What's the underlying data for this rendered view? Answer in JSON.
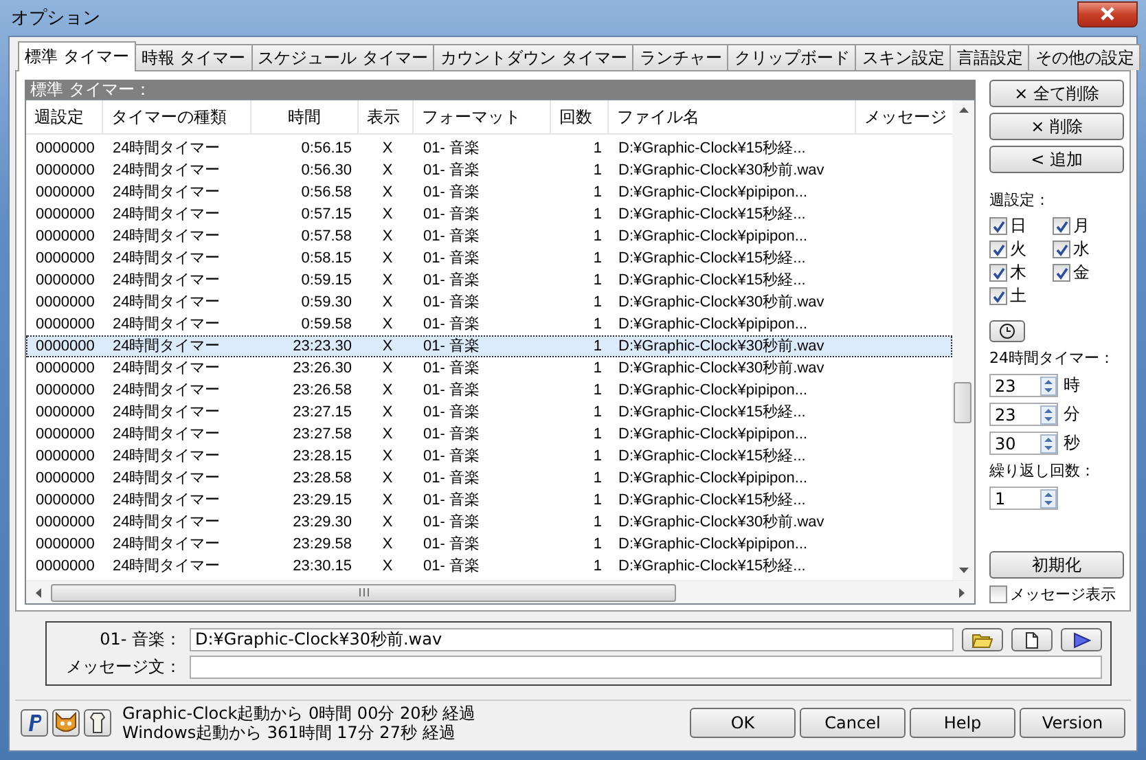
{
  "window": {
    "title": "オプション"
  },
  "tabs": [
    {
      "label": "標準 タイマー",
      "selected": true
    },
    {
      "label": "時報 タイマー",
      "selected": false
    },
    {
      "label": "スケジュール タイマー",
      "selected": false
    },
    {
      "label": "カウントダウン タイマー",
      "selected": false
    },
    {
      "label": "ランチャー",
      "selected": false
    },
    {
      "label": "クリップボード",
      "selected": false
    },
    {
      "label": "スキン設定",
      "selected": false
    },
    {
      "label": "言語設定",
      "selected": false
    },
    {
      "label": "その他の設定",
      "selected": false
    }
  ],
  "table": {
    "group_label": "標準 タイマー：",
    "columns": [
      "週設定",
      "タイマーの種類",
      "時間",
      "表示",
      "フォーマット",
      "回数",
      "ファイル名",
      "メッセージ"
    ],
    "rows": [
      {
        "cells": [
          "0000000",
          "24時間タイマー",
          "0:56.15",
          "X",
          "01- 音楽",
          "1",
          "D:¥Graphic-Clock¥15秒経..."
        ],
        "selected": false
      },
      {
        "cells": [
          "0000000",
          "24時間タイマー",
          "0:56.30",
          "X",
          "01- 音楽",
          "1",
          "D:¥Graphic-Clock¥30秒前.wav"
        ],
        "selected": false
      },
      {
        "cells": [
          "0000000",
          "24時間タイマー",
          "0:56.58",
          "X",
          "01- 音楽",
          "1",
          "D:¥Graphic-Clock¥pipipon..."
        ],
        "selected": false
      },
      {
        "cells": [
          "0000000",
          "24時間タイマー",
          "0:57.15",
          "X",
          "01- 音楽",
          "1",
          "D:¥Graphic-Clock¥15秒経..."
        ],
        "selected": false
      },
      {
        "cells": [
          "0000000",
          "24時間タイマー",
          "0:57.58",
          "X",
          "01- 音楽",
          "1",
          "D:¥Graphic-Clock¥pipipon..."
        ],
        "selected": false
      },
      {
        "cells": [
          "0000000",
          "24時間タイマー",
          "0:58.15",
          "X",
          "01- 音楽",
          "1",
          "D:¥Graphic-Clock¥15秒経..."
        ],
        "selected": false
      },
      {
        "cells": [
          "0000000",
          "24時間タイマー",
          "0:59.15",
          "X",
          "01- 音楽",
          "1",
          "D:¥Graphic-Clock¥15秒経..."
        ],
        "selected": false
      },
      {
        "cells": [
          "0000000",
          "24時間タイマー",
          "0:59.30",
          "X",
          "01- 音楽",
          "1",
          "D:¥Graphic-Clock¥30秒前.wav"
        ],
        "selected": false
      },
      {
        "cells": [
          "0000000",
          "24時間タイマー",
          "0:59.58",
          "X",
          "01- 音楽",
          "1",
          "D:¥Graphic-Clock¥pipipon..."
        ],
        "selected": false
      },
      {
        "cells": [
          "0000000",
          "24時間タイマー",
          "23:23.30",
          "X",
          "01- 音楽",
          "1",
          "D:¥Graphic-Clock¥30秒前.wav"
        ],
        "selected": true
      },
      {
        "cells": [
          "0000000",
          "24時間タイマー",
          "23:26.30",
          "X",
          "01- 音楽",
          "1",
          "D:¥Graphic-Clock¥30秒前.wav"
        ],
        "selected": false
      },
      {
        "cells": [
          "0000000",
          "24時間タイマー",
          "23:26.58",
          "X",
          "01- 音楽",
          "1",
          "D:¥Graphic-Clock¥pipipon..."
        ],
        "selected": false
      },
      {
        "cells": [
          "0000000",
          "24時間タイマー",
          "23:27.15",
          "X",
          "01- 音楽",
          "1",
          "D:¥Graphic-Clock¥15秒経..."
        ],
        "selected": false
      },
      {
        "cells": [
          "0000000",
          "24時間タイマー",
          "23:27.58",
          "X",
          "01- 音楽",
          "1",
          "D:¥Graphic-Clock¥pipipon..."
        ],
        "selected": false
      },
      {
        "cells": [
          "0000000",
          "24時間タイマー",
          "23:28.15",
          "X",
          "01- 音楽",
          "1",
          "D:¥Graphic-Clock¥15秒経..."
        ],
        "selected": false
      },
      {
        "cells": [
          "0000000",
          "24時間タイマー",
          "23:28.58",
          "X",
          "01- 音楽",
          "1",
          "D:¥Graphic-Clock¥pipipon..."
        ],
        "selected": false
      },
      {
        "cells": [
          "0000000",
          "24時間タイマー",
          "23:29.15",
          "X",
          "01- 音楽",
          "1",
          "D:¥Graphic-Clock¥15秒経..."
        ],
        "selected": false
      },
      {
        "cells": [
          "0000000",
          "24時間タイマー",
          "23:29.30",
          "X",
          "01- 音楽",
          "1",
          "D:¥Graphic-Clock¥30秒前.wav"
        ],
        "selected": false
      },
      {
        "cells": [
          "0000000",
          "24時間タイマー",
          "23:29.58",
          "X",
          "01- 音楽",
          "1",
          "D:¥Graphic-Clock¥pipipon..."
        ],
        "selected": false
      },
      {
        "cells": [
          "0000000",
          "24時間タイマー",
          "23:30.15",
          "X",
          "01- 音楽",
          "1",
          "D:¥Graphic-Clock¥15秒経..."
        ],
        "selected": false
      }
    ]
  },
  "side": {
    "buttons": [
      "× 全て削除",
      "× 削除",
      "< 追加"
    ],
    "week_label": "週設定：",
    "days": [
      {
        "label": "日",
        "checked": true
      },
      {
        "label": "月",
        "checked": true
      },
      {
        "label": "火",
        "checked": true
      },
      {
        "label": "水",
        "checked": true
      },
      {
        "label": "木",
        "checked": true
      },
      {
        "label": "金",
        "checked": true
      },
      {
        "label": "土",
        "checked": true
      }
    ],
    "timer_label": "24時間タイマー：",
    "spinners": [
      {
        "value": "23",
        "unit": "時"
      },
      {
        "value": "23",
        "unit": "分"
      },
      {
        "value": "30",
        "unit": "秒"
      }
    ],
    "repeat_label": "繰り返し回数：",
    "repeat_value": "1",
    "reset_button": "初期化",
    "message_checkbox": {
      "label": "メッセージ表示",
      "checked": false
    }
  },
  "detail": {
    "format_label": "01- 音楽：",
    "file_value": "D:¥Graphic-Clock¥30秒前.wav",
    "message_label": "メッセージ文："
  },
  "status": {
    "lines": [
      "Graphic-Clock起動から 0時間 00分 20秒 経過",
      "Windows起動から 361時間 17分 27秒 経過"
    ],
    "buttons": [
      "OK",
      "Cancel",
      "Help",
      "Version"
    ]
  }
}
